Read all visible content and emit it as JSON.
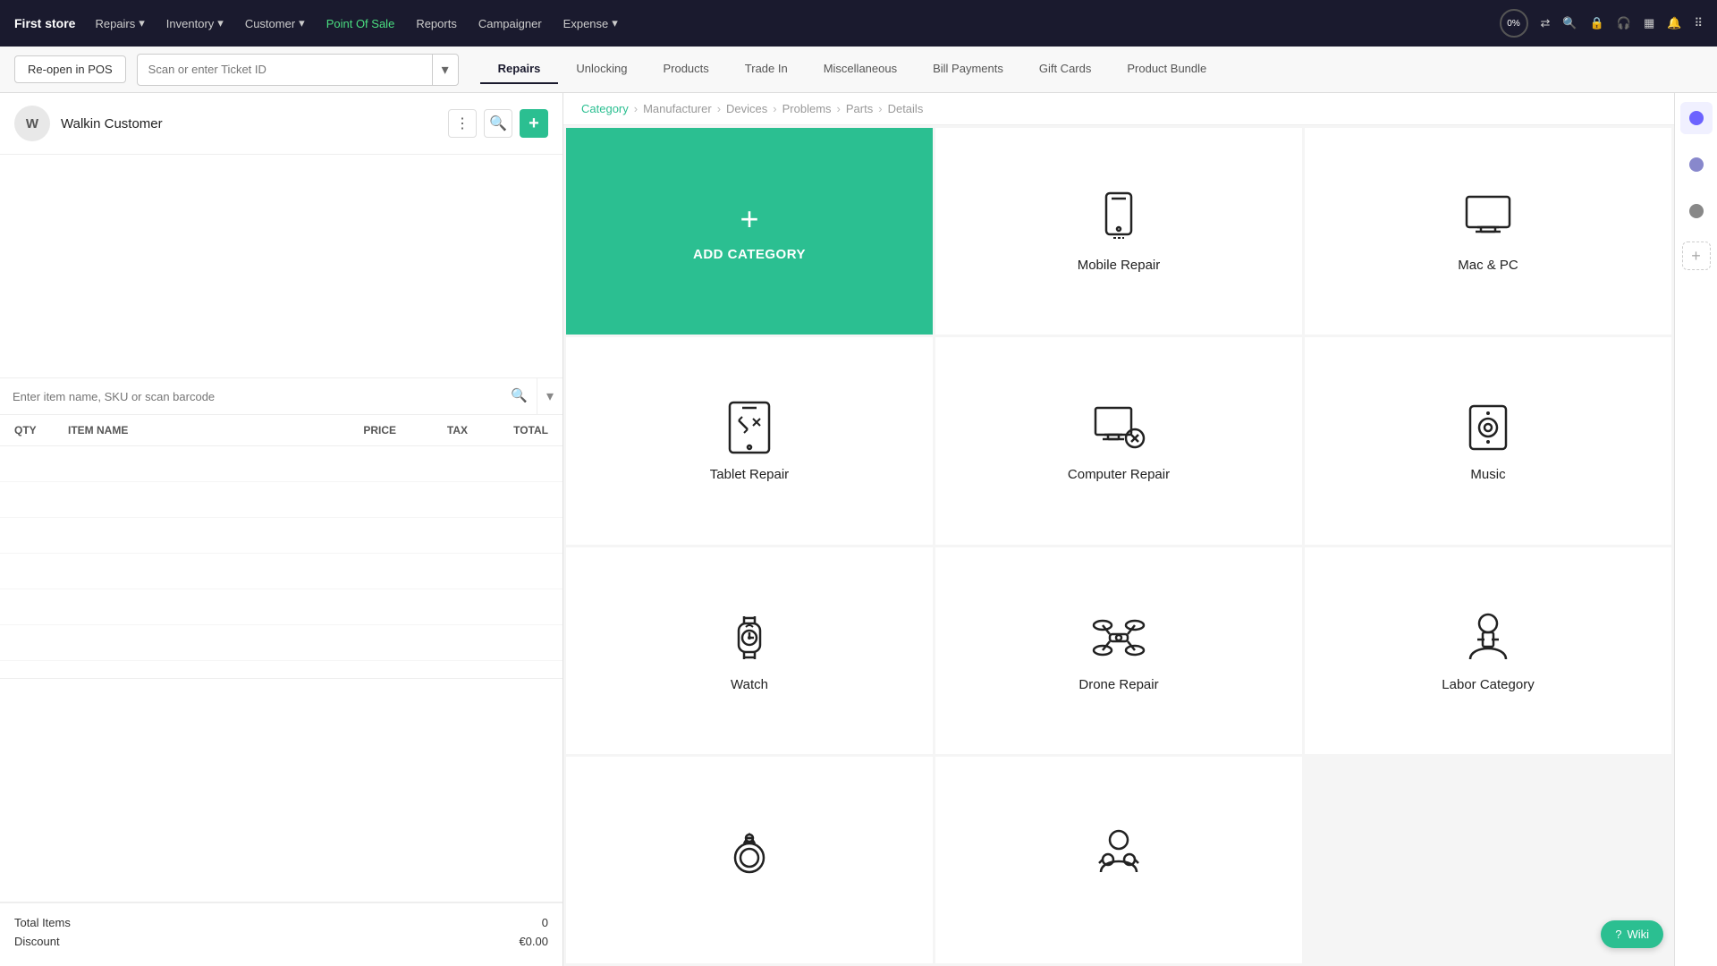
{
  "topnav": {
    "brand": "First store",
    "items": [
      {
        "label": "Repairs",
        "hasArrow": true,
        "active": false
      },
      {
        "label": "Inventory",
        "hasArrow": true,
        "active": false
      },
      {
        "label": "Customer",
        "hasArrow": true,
        "active": false
      },
      {
        "label": "Point Of Sale",
        "hasArrow": false,
        "active": true
      },
      {
        "label": "Reports",
        "hasArrow": false,
        "active": false
      },
      {
        "label": "Campaigner",
        "hasArrow": false,
        "active": false
      },
      {
        "label": "Expense",
        "hasArrow": true,
        "active": false
      }
    ],
    "progress_label": "0%",
    "right_icons": [
      "sync-icon",
      "search-icon",
      "lock-icon",
      "headset-icon",
      "pos-icon",
      "bell-icon",
      "grid-icon"
    ]
  },
  "secondnav": {
    "reopen_label": "Re-open in POS",
    "ticket_placeholder": "Scan or enter Ticket ID",
    "tabs": [
      {
        "label": "Repairs",
        "active": true
      },
      {
        "label": "Unlocking",
        "active": false
      },
      {
        "label": "Products",
        "active": false
      },
      {
        "label": "Trade In",
        "active": false
      },
      {
        "label": "Miscellaneous",
        "active": false
      },
      {
        "label": "Bill Payments",
        "active": false
      },
      {
        "label": "Gift Cards",
        "active": false
      },
      {
        "label": "Product Bundle",
        "active": false
      }
    ]
  },
  "customer": {
    "initials": "W",
    "name": "Walkin Customer"
  },
  "itemsearch": {
    "placeholder": "Enter item name, SKU or scan barcode"
  },
  "table": {
    "headers": [
      "QTY",
      "ITEM NAME",
      "PRICE",
      "TAX",
      "TOTAL"
    ]
  },
  "totals": {
    "items_label": "Total Items",
    "items_value": "0",
    "discount_label": "Discount",
    "discount_value": "€0.00"
  },
  "breadcrumb": {
    "items": [
      {
        "label": "Category",
        "active": true
      },
      {
        "label": "Manufacturer",
        "active": false
      },
      {
        "label": "Devices",
        "active": false
      },
      {
        "label": "Problems",
        "active": false
      },
      {
        "label": "Parts",
        "active": false
      },
      {
        "label": "Details",
        "active": false
      }
    ]
  },
  "categories": [
    {
      "id": "add",
      "label": "ADD CATEGORY",
      "type": "add"
    },
    {
      "id": "mobile-repair",
      "label": "Mobile Repair",
      "type": "card",
      "icon": "mobile"
    },
    {
      "id": "mac-pc",
      "label": "Mac & PC",
      "type": "card",
      "icon": "desktop"
    },
    {
      "id": "tablet-repair",
      "label": "Tablet Repair",
      "type": "card",
      "icon": "tablet"
    },
    {
      "id": "computer-repair",
      "label": "Computer Repair",
      "type": "card",
      "icon": "computer-gear"
    },
    {
      "id": "music",
      "label": "Music",
      "type": "card",
      "icon": "music-player"
    },
    {
      "id": "watch",
      "label": "Watch",
      "type": "card",
      "icon": "watch"
    },
    {
      "id": "drone-repair",
      "label": "Drone Repair",
      "type": "card",
      "icon": "drone"
    },
    {
      "id": "labor-category",
      "label": "Labor Category",
      "type": "card",
      "icon": "labor"
    },
    {
      "id": "ring",
      "label": "",
      "type": "card",
      "icon": "ring"
    },
    {
      "id": "support",
      "label": "",
      "type": "card",
      "icon": "support"
    }
  ],
  "wiki": {
    "label": "Wiki"
  }
}
